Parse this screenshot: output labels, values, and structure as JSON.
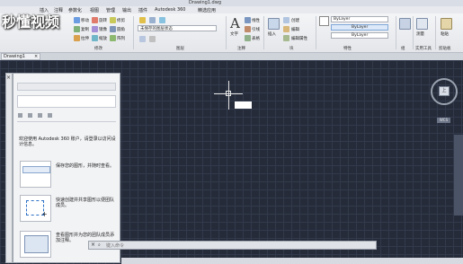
{
  "window": {
    "title": "Drawing1.dwg"
  },
  "watermark": {
    "text": "秒懂视频"
  },
  "menubar": {
    "items": [
      "插入",
      "注释",
      "参数化",
      "视图",
      "管理",
      "输出",
      "插件",
      "Autodesk 360",
      "精选应用"
    ]
  },
  "ribbon": {
    "modify": {
      "label": "修改",
      "items": [
        "移动",
        "旋转",
        "修剪",
        "复制",
        "镜像",
        "圆角",
        "拉伸",
        "缩放",
        "阵列"
      ]
    },
    "layers": {
      "label": "图层",
      "unsaved_state": "未保存的图层状态"
    },
    "annotation": {
      "label": "注释",
      "text": "文字",
      "dimension": "标注",
      "linear": "线性",
      "leader": "引线",
      "table": "表格"
    },
    "block": {
      "label": "块",
      "insert": "插入",
      "create": "创建",
      "edit": "编辑",
      "edit_attribute": "编辑属性"
    },
    "properties": {
      "label": "特性",
      "bylayer1": "ByLayer",
      "bylayer2": "ByLayer",
      "bylayer3": "ByLayer"
    },
    "groups": {
      "label": "组"
    },
    "utilities": {
      "label": "实用工具",
      "measure": "测量"
    },
    "clipboard": {
      "label": "剪贴板",
      "paste": "粘贴"
    }
  },
  "tabs": {
    "document": "Drawing1"
  },
  "panel": {
    "intro": "欢迎使用 Autodesk 360 账户，请登录以访问设计信息。",
    "tips": [
      "保存您的图形，并随时查看。",
      "快速创建并共享图形以便团队成员。",
      "查看图形并为您的团队成员添加注释。"
    ]
  },
  "viewcube": {
    "face": "上",
    "wcs": "WCS"
  },
  "commandline": {
    "placeholder": "键入命令"
  }
}
